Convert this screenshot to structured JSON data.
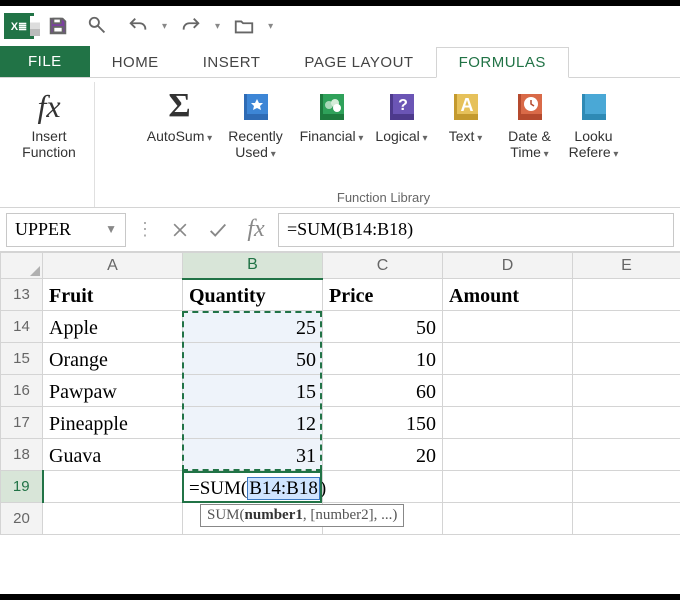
{
  "tabs": {
    "file": "FILE",
    "home": "HOME",
    "insert": "INSERT",
    "page_layout": "PAGE LAYOUT",
    "formulas": "FORMULAS"
  },
  "ribbon": {
    "insert_function": "Insert\nFunction",
    "autosum": "AutoSum",
    "recently_used": "Recently\nUsed",
    "financial": "Financial",
    "logical": "Logical",
    "text": "Text",
    "date_time": "Date &\nTime",
    "lookup": "Looku\nRefere",
    "group_label": "Function Library"
  },
  "namebox": {
    "value": "UPPER"
  },
  "formula_bar": {
    "value": "=SUM(B14:B18)"
  },
  "columns": [
    "A",
    "B",
    "C",
    "D",
    "E"
  ],
  "visible_rows": [
    13,
    14,
    15,
    16,
    17,
    18,
    19,
    20
  ],
  "cells": {
    "A13": "Fruit",
    "B13": "Quantity",
    "C13": "Price",
    "D13": "Amount",
    "A14": "Apple",
    "B14": "25",
    "C14": "50",
    "A15": "Orange",
    "B15": "50",
    "C15": "10",
    "A16": "Pawpaw",
    "B16": "15",
    "C16": "60",
    "A17": "Pineapple",
    "B17": "12",
    "C17": "150",
    "A18": "Guava",
    "B18": "31",
    "C18": "20"
  },
  "active_cell_formula": {
    "prefix": "=SUM(",
    "ref": "B14:B18",
    "suffix": ")"
  },
  "tooltip": {
    "fn": "SUM",
    "args": "(number1, [number2], ...)"
  },
  "chart_data": {
    "type": "table",
    "columns": [
      "Fruit",
      "Quantity",
      "Price",
      "Amount"
    ],
    "rows": [
      {
        "Fruit": "Apple",
        "Quantity": 25,
        "Price": 50
      },
      {
        "Fruit": "Orange",
        "Quantity": 50,
        "Price": 10
      },
      {
        "Fruit": "Pawpaw",
        "Quantity": 15,
        "Price": 60
      },
      {
        "Fruit": "Pineapple",
        "Quantity": 12,
        "Price": 150
      },
      {
        "Fruit": "Guava",
        "Quantity": 31,
        "Price": 20
      }
    ],
    "selection": "B14:B18",
    "active_cell": "B19",
    "formula": "=SUM(B14:B18)"
  }
}
